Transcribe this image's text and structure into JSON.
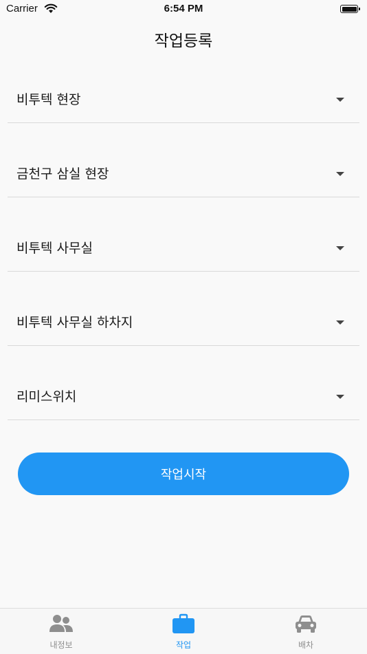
{
  "status_bar": {
    "carrier": "Carrier",
    "time": "6:54 PM"
  },
  "header": {
    "title": "작업등록"
  },
  "dropdowns": [
    {
      "label": "비투텍 현장"
    },
    {
      "label": "금천구 삼실 현장"
    },
    {
      "label": "비투텍 사무실"
    },
    {
      "label": "비투텍 사무실 하차지"
    },
    {
      "label": "리미스위치"
    }
  ],
  "start_button": {
    "label": "작업시작"
  },
  "tabs": [
    {
      "label": "내정보",
      "icon": "people-icon",
      "active": false
    },
    {
      "label": "작업",
      "icon": "briefcase-icon",
      "active": true
    },
    {
      "label": "배차",
      "icon": "car-icon",
      "active": false
    }
  ],
  "colors": {
    "accent": "#2196f3",
    "inactive": "#8e8e8e"
  }
}
